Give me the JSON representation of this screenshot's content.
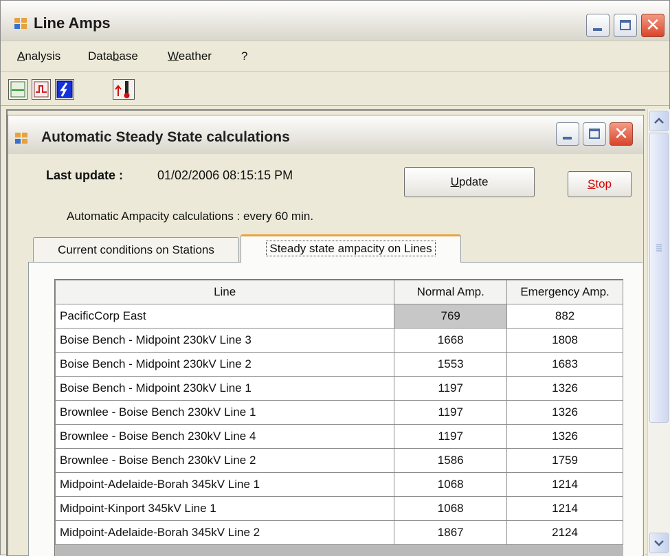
{
  "window": {
    "title": "Line Amps"
  },
  "menu": [
    {
      "label": "Analysis",
      "mnemonic": "A"
    },
    {
      "label": "Database",
      "mnemonic": "b"
    },
    {
      "label": "Weather",
      "mnemonic": "W"
    },
    {
      "label": "?",
      "mnemonic": ""
    }
  ],
  "toolbar": [
    {
      "icon": "line-chart-icon"
    },
    {
      "icon": "pulse-chart-icon"
    },
    {
      "icon": "lightning-icon"
    },
    {
      "icon": "thermometer-icon"
    }
  ],
  "child": {
    "title": "Automatic Steady State calculations",
    "last_update_label": "Last update :",
    "last_update_value": "01/02/2006 08:15:15 PM",
    "update_button": "Update",
    "update_button_mnemonic": "U",
    "stop_button": "Stop",
    "stop_button_mnemonic": "S",
    "auto_text": "Automatic Ampacity calculations : every 60 min.",
    "tabs": [
      {
        "label": "Current conditions on Stations",
        "active": false
      },
      {
        "label": "Steady state ampacity on Lines",
        "active": true
      }
    ],
    "table": {
      "headers": [
        "Line",
        "Normal Amp.",
        "Emergency Amp."
      ],
      "rows": [
        [
          "PacificCorp East",
          "769",
          "882"
        ],
        [
          "Boise Bench - Midpoint 230kV Line 3",
          "1668",
          "1808"
        ],
        [
          "Boise Bench - Midpoint 230kV Line 2",
          "1553",
          "1683"
        ],
        [
          "Boise Bench - Midpoint 230kV Line 1",
          "1197",
          "1326"
        ],
        [
          "Brownlee - Boise Bench 230kV Line 1",
          "1197",
          "1326"
        ],
        [
          "Brownlee - Boise Bench 230kV Line 4",
          "1197",
          "1326"
        ],
        [
          "Brownlee - Boise Bench 230kV Line 2",
          "1586",
          "1759"
        ],
        [
          "Midpoint-Adelaide-Borah 345kV Line 1",
          "1068",
          "1214"
        ],
        [
          "Midpoint-Kinport 345kV Line 1",
          "1068",
          "1214"
        ],
        [
          "Midpoint-Adelaide-Borah 345kV Line 2",
          "1867",
          "2124"
        ]
      ]
    }
  },
  "colors": {
    "accent_blue": "#4a6aa3",
    "close_red": "#d9452a",
    "stop_red": "#d10000"
  }
}
